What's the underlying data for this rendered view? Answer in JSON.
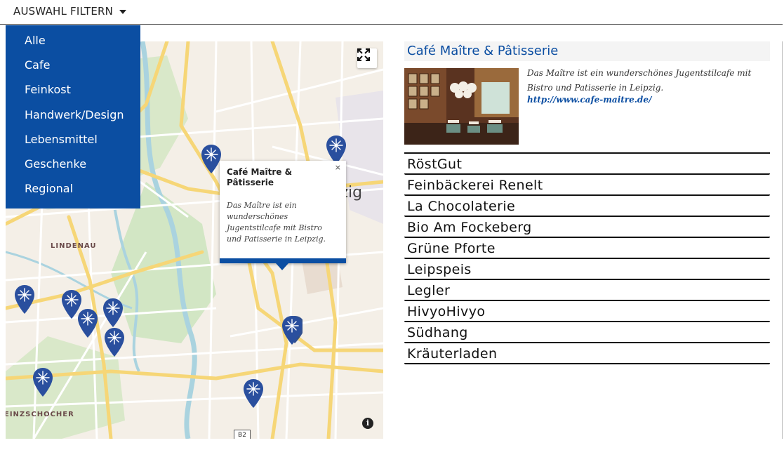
{
  "filter": {
    "label": "AUSWAHL FILTERN",
    "options": [
      "Alle",
      "Cafe",
      "Feinkost",
      "Handwerk/Design",
      "Lebensmittel",
      "Geschenke",
      "Regional"
    ]
  },
  "map": {
    "city_label": "Leipzig",
    "district_lindenau": "LINDENAU",
    "district_schleussig": "EINZSCHOCHER",
    "road_badge": "B2",
    "info_button": "i",
    "popup": {
      "title": "Café Maître & Pâtisserie",
      "description": "Das Maître ist ein wunderschönes Jugentstilcafe mit Bistro und Patisserie in Leipzig.",
      "close": "×"
    },
    "marker_color": "#2a4f9e"
  },
  "detail": {
    "title": "Café Maître & Pâtisserie",
    "description": "Das Maître ist ein wunderschönes Jugentstilcafe mit Bistro und Patisserie in Leipzig.",
    "link": "http://www.cafe-maitre.de/"
  },
  "shops": [
    "RöstGut",
    "Feinbäckerei Renelt",
    "La Chocolaterie",
    "Bio Am Fockeberg",
    "Grüne Pforte",
    "Leipspeis",
    "Legler",
    "HivyoHivyo",
    "Südhang",
    "Kräuterladen"
  ],
  "colors": {
    "accent": "#0b4ea2",
    "map_background": "#f4efe7",
    "road_major": "#f6d677",
    "water": "#aad3df",
    "park": "#d2e6c4"
  }
}
